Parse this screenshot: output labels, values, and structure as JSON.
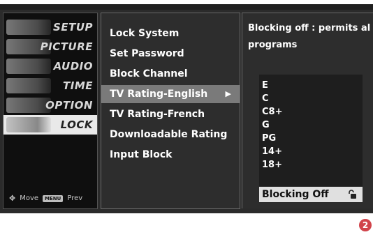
{
  "categories": [
    {
      "label": "SETUP",
      "selected": false
    },
    {
      "label": "PICTURE",
      "selected": false
    },
    {
      "label": "AUDIO",
      "selected": false
    },
    {
      "label": "TIME",
      "selected": false
    },
    {
      "label": "OPTION",
      "selected": false
    },
    {
      "label": "LOCK",
      "selected": true
    }
  ],
  "hint": {
    "move": "Move",
    "menu_key": "MENU",
    "prev": "Prev"
  },
  "menu_items": [
    {
      "label": "Lock System",
      "selected": false
    },
    {
      "label": "Set Password",
      "selected": false
    },
    {
      "label": "Block Channel",
      "selected": false
    },
    {
      "label": "TV Rating-English",
      "selected": true,
      "arrow": "▶"
    },
    {
      "label": "TV Rating-French",
      "selected": false
    },
    {
      "label": "Downloadable Rating",
      "selected": false
    },
    {
      "label": "Input Block",
      "selected": false
    }
  ],
  "description": {
    "line1": "Blocking off : permits al",
    "line2": "programs"
  },
  "ratings": [
    "E",
    "C",
    "C8+",
    "G",
    "PG",
    "14+",
    "18+"
  ],
  "blocking": {
    "label": "Blocking Off",
    "icon": "unlocked-padlock-icon"
  },
  "page_number": "2",
  "colors": {
    "selected_category": "#e9e9e9",
    "selected_item": "#7a7a7a",
    "badge": "#d1444b"
  }
}
